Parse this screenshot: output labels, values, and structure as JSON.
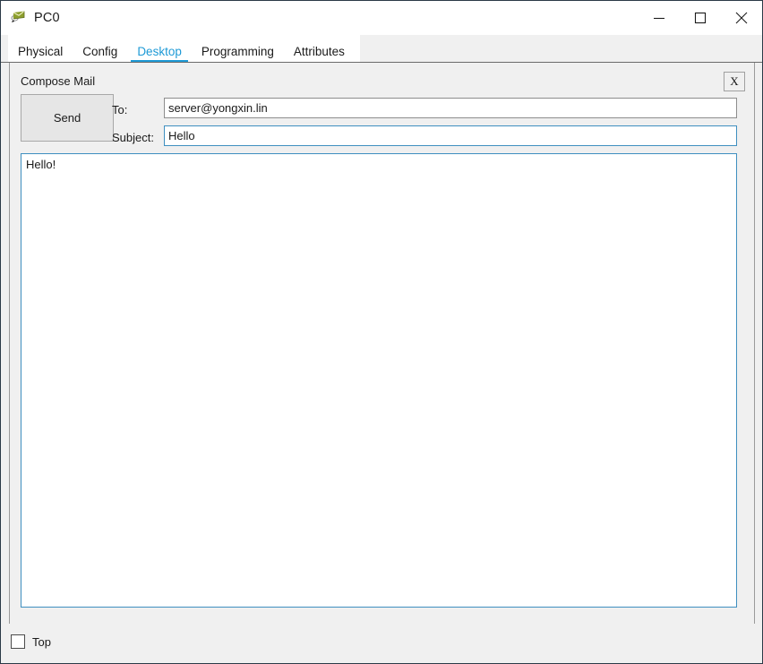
{
  "window": {
    "title": "PC0",
    "icon": "packet-tracer-pc-icon",
    "controls": {
      "minimize": "minimize-icon",
      "maximize": "maximize-icon",
      "close": "close-icon"
    }
  },
  "tabs": [
    {
      "label": "Physical",
      "active": false
    },
    {
      "label": "Config",
      "active": false
    },
    {
      "label": "Desktop",
      "active": true
    },
    {
      "label": "Programming",
      "active": false
    },
    {
      "label": "Attributes",
      "active": false
    }
  ],
  "panel": {
    "title": "Compose Mail",
    "close_label": "X",
    "send_label": "Send",
    "fields": {
      "to_label": "To:",
      "to_value": "server@yongxin.lin",
      "to_placeholder": "",
      "subject_label": "Subject:",
      "subject_value": "Hello",
      "subject_placeholder": ""
    },
    "message_body": "Hello!",
    "message_placeholder": ""
  },
  "footer": {
    "top_checkbox_label": "Top",
    "top_checkbox_checked": false
  },
  "colors": {
    "accent": "#1e9ad6",
    "focus_border": "#3f8fc0",
    "window_bg": "#f0f0f0",
    "frame_border": "#2b3a47"
  }
}
